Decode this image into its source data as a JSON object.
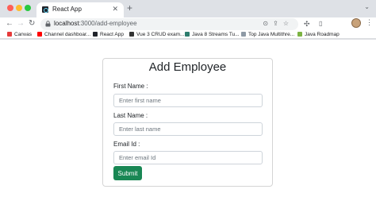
{
  "browser": {
    "tab": {
      "title": "React App"
    },
    "address_bar": {
      "host": "localhost",
      "path": ":3000/add-employee"
    },
    "bookmarks": [
      {
        "label": "Canvas",
        "icon": "canvas-icon",
        "color": "#e63b3b"
      },
      {
        "label": "Channel dashboar...",
        "icon": "youtube-icon",
        "color": "#ff0000"
      },
      {
        "label": "React App",
        "icon": "react-icon",
        "color": "#20232a"
      },
      {
        "label": "Vue 3 CRUD exam...",
        "icon": "bezkoder-icon",
        "color": "#333333"
      },
      {
        "label": "Java 8 Streams Tu...",
        "icon": "page-icon",
        "color": "#2e7d6e"
      },
      {
        "label": "Top Java Multithre...",
        "icon": "globe-icon",
        "color": "#8e9aa6"
      },
      {
        "label": "Java Roadmap",
        "icon": "roadmap-icon",
        "color": "#7cb342"
      }
    ]
  },
  "form": {
    "title": "Add Employee",
    "first_name": {
      "label": "First Name :",
      "placeholder": "Enter first name"
    },
    "last_name": {
      "label": "Last Name :",
      "placeholder": "Enter last name"
    },
    "email": {
      "label": "Email Id :",
      "placeholder": "Enter email Id"
    },
    "submit_label": "Submit"
  },
  "colors": {
    "submit": "#198754",
    "tab_strip": "#dee1e6"
  }
}
